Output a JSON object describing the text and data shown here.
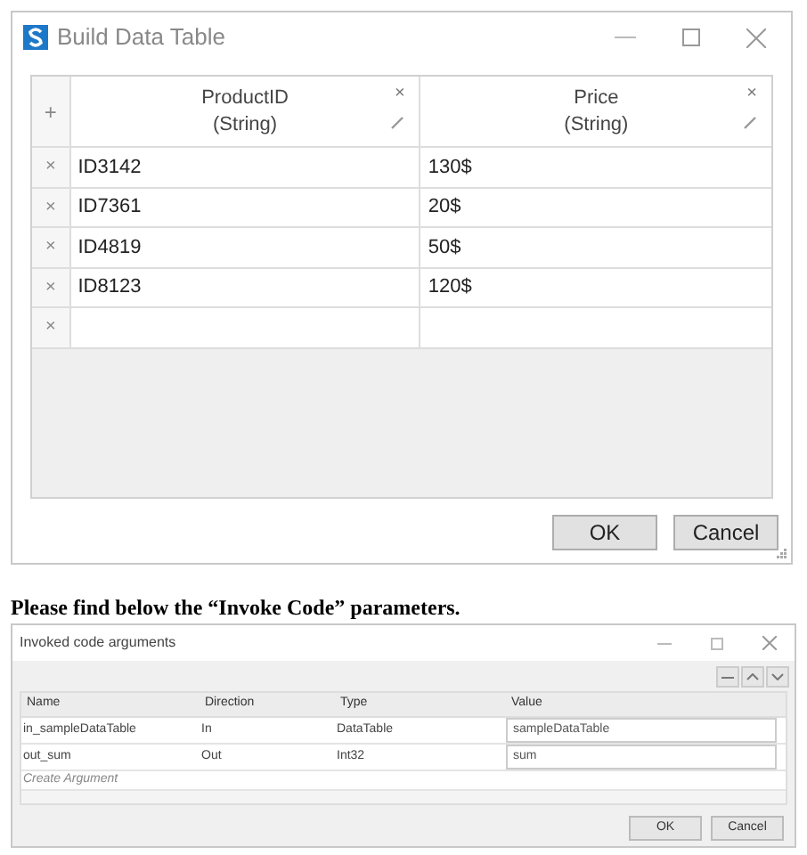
{
  "window": {
    "title": "Build Data Table",
    "add_column": "+",
    "columns": [
      {
        "name": "ProductID",
        "type": "(String)",
        "remove": "×"
      },
      {
        "name": "Price",
        "type": "(String)",
        "remove": "×"
      }
    ],
    "rows": [
      {
        "remove": "×",
        "cells": [
          "ID3142",
          "130$"
        ]
      },
      {
        "remove": "×",
        "cells": [
          "ID7361",
          "20$"
        ]
      },
      {
        "remove": "×",
        "cells": [
          "ID4819",
          "50$"
        ]
      },
      {
        "remove": "×",
        "cells": [
          "ID8123",
          "120$"
        ]
      },
      {
        "remove": "×",
        "cells": [
          "",
          ""
        ]
      }
    ],
    "buttons": [
      "OK",
      "Cancel"
    ]
  },
  "caption": "Please find below the “Invoke Code” parameters.",
  "arguments_window": {
    "title": "Invoked code arguments",
    "columns": [
      "Name",
      "Direction",
      "Type",
      "Value"
    ],
    "rows": [
      {
        "cells": [
          "in_sampleDataTable",
          "In",
          "DataTable",
          "sampleDataTable"
        ]
      },
      {
        "cells": [
          "out_sum",
          "Out",
          "Int32",
          "sum"
        ]
      }
    ],
    "create_placeholder": "Create Argument",
    "buttons": [
      "OK",
      "Cancel"
    ]
  }
}
